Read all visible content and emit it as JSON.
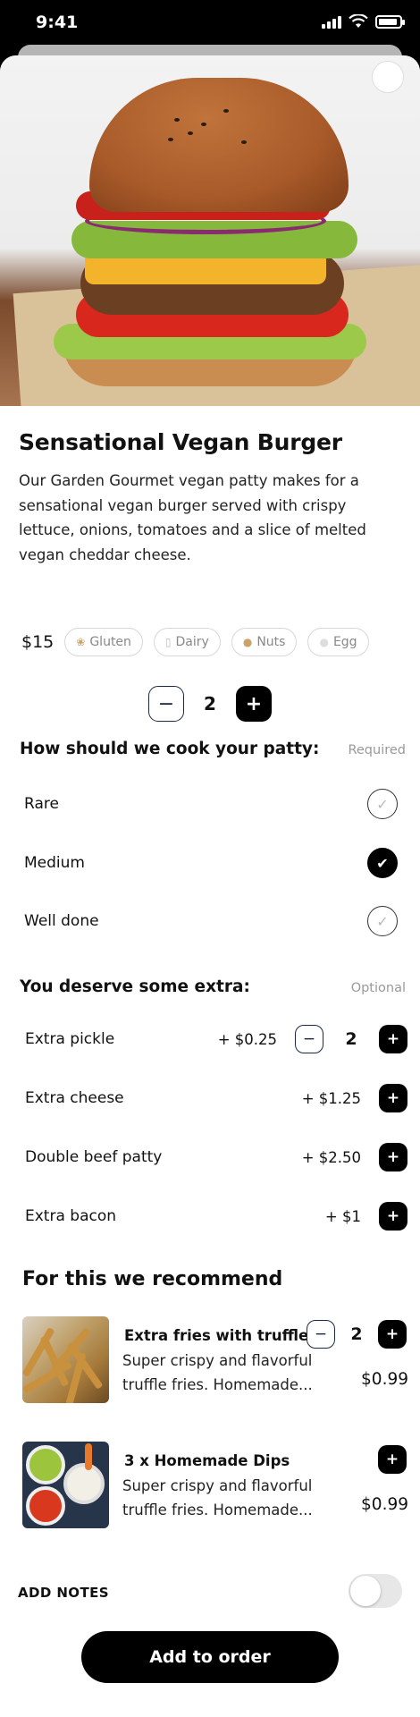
{
  "status_bar": {
    "time": "9:41",
    "icons": [
      "signal-icon",
      "wifi-icon",
      "battery-icon"
    ]
  },
  "product": {
    "title": "Sensational Vegan Burger",
    "description": "Our Garden Gourmet vegan patty makes for a sensational vegan burger served with crispy lettuce,  onions, tomatoes and a slice of melted vegan cheddar cheese.",
    "price": "$15",
    "allergens": [
      {
        "label": "Gluten",
        "icon": "wheat-icon"
      },
      {
        "label": "Dairy",
        "icon": "milk-icon"
      },
      {
        "label": "Nuts",
        "icon": "peanut-icon"
      },
      {
        "label": "Egg",
        "icon": "egg-icon"
      }
    ],
    "quantity": "2"
  },
  "cooking": {
    "heading": "How should we cook your patty:",
    "tag": "Required",
    "options": [
      {
        "label": "Rare",
        "selected": false
      },
      {
        "label": "Medium",
        "selected": true
      },
      {
        "label": "Well done",
        "selected": false
      }
    ]
  },
  "extras": {
    "heading": "You deserve some extra:",
    "tag": "Optional",
    "items": [
      {
        "name": "Extra pickle",
        "price": "+ $0.25",
        "qty": "2"
      },
      {
        "name": "Extra cheese",
        "price": "+ $1.25"
      },
      {
        "name": "Double beef patty",
        "price": "+ $2.50"
      },
      {
        "name": "Extra bacon",
        "price": "+ $1"
      }
    ]
  },
  "recommend": {
    "heading": "For this we recommend",
    "items": [
      {
        "name": "Extra fries with truffle",
        "desc_line1": "Super crispy and flavorful",
        "desc_line2": "truffle fries. Homemade...",
        "price": "$0.99",
        "qty": "2"
      },
      {
        "name": "3 x Homemade Dips",
        "desc_line1": "Super crispy and flavorful",
        "desc_line2": "truffle fries. Homemade...",
        "price": "$0.99"
      }
    ]
  },
  "notes": {
    "label": "ADD NOTES",
    "enabled": false
  },
  "cta": {
    "label": "Add to order"
  },
  "controls": {
    "minus": "−",
    "plus": "+",
    "check": "✓",
    "check_on": "✔"
  },
  "colors": {
    "accent": "#000000",
    "outline": "#1b2a44",
    "muted": "#999999"
  }
}
